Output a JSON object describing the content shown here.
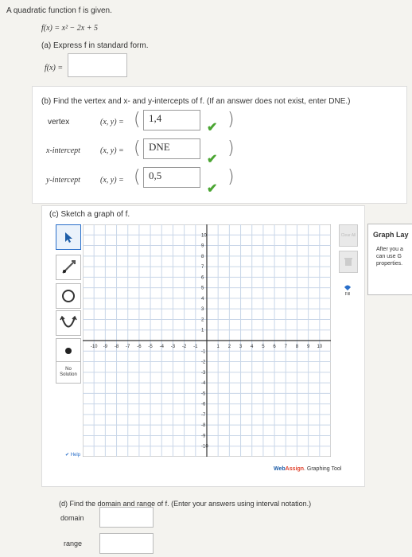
{
  "problem": {
    "intro": "A quadratic function f is given.",
    "function": "f(x) = x² − 2x + 5",
    "part_a": "(a) Express f in standard form.",
    "fx_label": "f(x) =",
    "part_b": "(b) Find the vertex and x- and y-intercepts of f. (If an answer does not exist, enter DNE.)",
    "vertex_label": "vertex",
    "xint_label": "x-intercept",
    "yint_label": "y-intercept",
    "xy_eq": "(x, y) =",
    "vertex_value": "1,4",
    "xint_value": "DNE",
    "yint_value": "0,5",
    "part_c": "(c) Sketch a graph of f.",
    "part_d": "(d) Find the domain and range of f. (Enter your answers using interval notation.)",
    "domain_label": "domain",
    "range_label": "range"
  },
  "graph_tool": {
    "no_solution_label": "No\nSolution",
    "fill_label": "Fill",
    "clear_label": "Clear All",
    "delete_label": "Delete",
    "brand_web": "Web",
    "brand_assign": "Assign",
    "brand_suffix": ". Graphing Tool",
    "x_ticks": [
      "-10",
      "-9",
      "-8",
      "-7",
      "-6",
      "-5",
      "-4",
      "-3",
      "-2",
      "-1",
      "1",
      "2",
      "3",
      "4",
      "5",
      "6",
      "7",
      "8",
      "9",
      "10"
    ],
    "y_ticks": [
      "10",
      "9",
      "8",
      "7",
      "6",
      "5",
      "4",
      "3",
      "2",
      "1",
      "-1",
      "-2",
      "-3",
      "-4",
      "-5",
      "-6",
      "-7",
      "-8",
      "-9",
      "-10"
    ]
  },
  "side_panel": {
    "title": "Graph Lay",
    "text1": "After you a",
    "text2": "can use G",
    "text3": "properties."
  },
  "colors": {
    "check": "#4aa532",
    "accent": "#1e5ea8"
  }
}
